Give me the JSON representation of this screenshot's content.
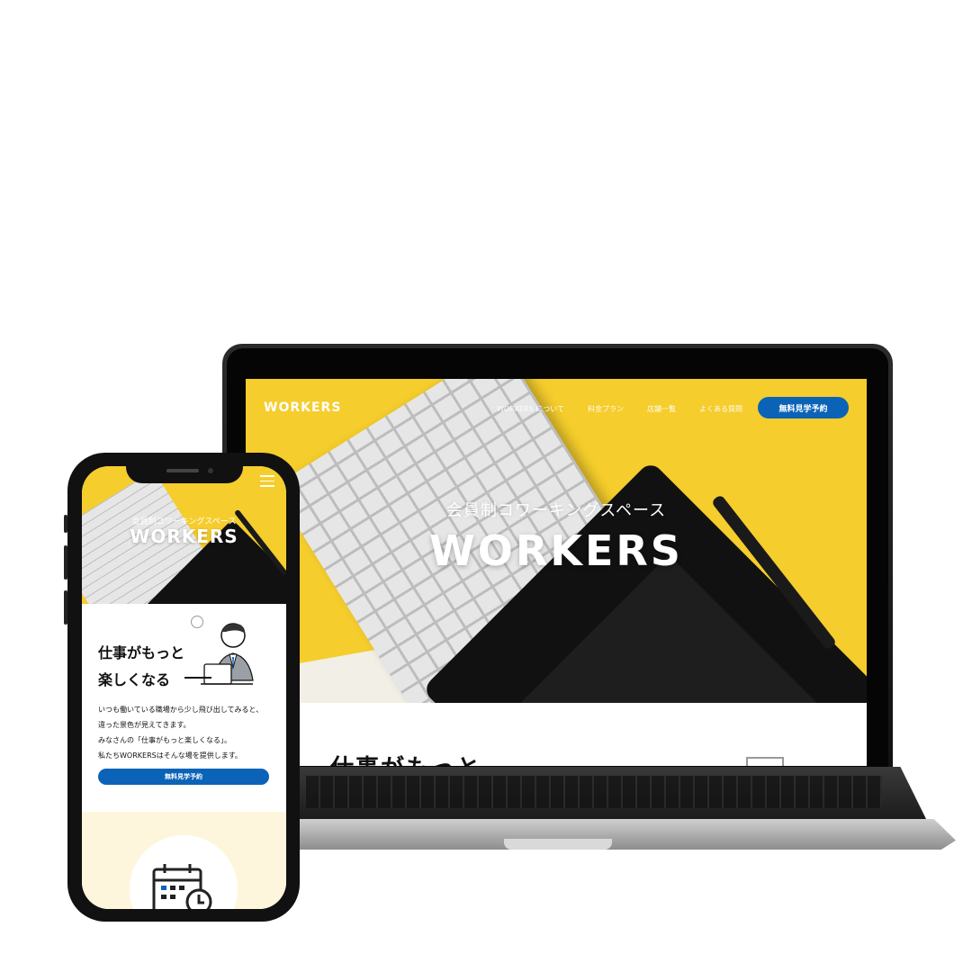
{
  "desktop": {
    "logo": "WORKERS",
    "nav": [
      "WORKERS について",
      "料金プラン",
      "店舗一覧",
      "よくある質問"
    ],
    "cta": "無料見学予約",
    "hero_sub": "会員制コワーキングスペース",
    "hero_title": "WORKERS",
    "section_title": "仕事がもっと",
    "scroll_icon": "chevron-up-icon"
  },
  "mobile": {
    "hero_sub": "会員制コワーキングスペース",
    "hero_title": "WORKERS",
    "menu_icon": "hamburger-icon",
    "heading_line1": "仕事がもっと",
    "heading_line2": "楽しくなる",
    "body": [
      "いつも働いている職場から少し飛び出してみると、",
      "違った景色が見えてきます。",
      "みなさんの「仕事がもっと楽しくなる」。",
      "私たちWORKERSはそんな場を提供します。"
    ],
    "cta": "無料見学予約",
    "calendar_icon": "calendar-clock-icon"
  },
  "colors": {
    "brand_yellow": "#f5cd2c",
    "brand_blue": "#0b63b7",
    "cream": "#fdf6dd"
  }
}
